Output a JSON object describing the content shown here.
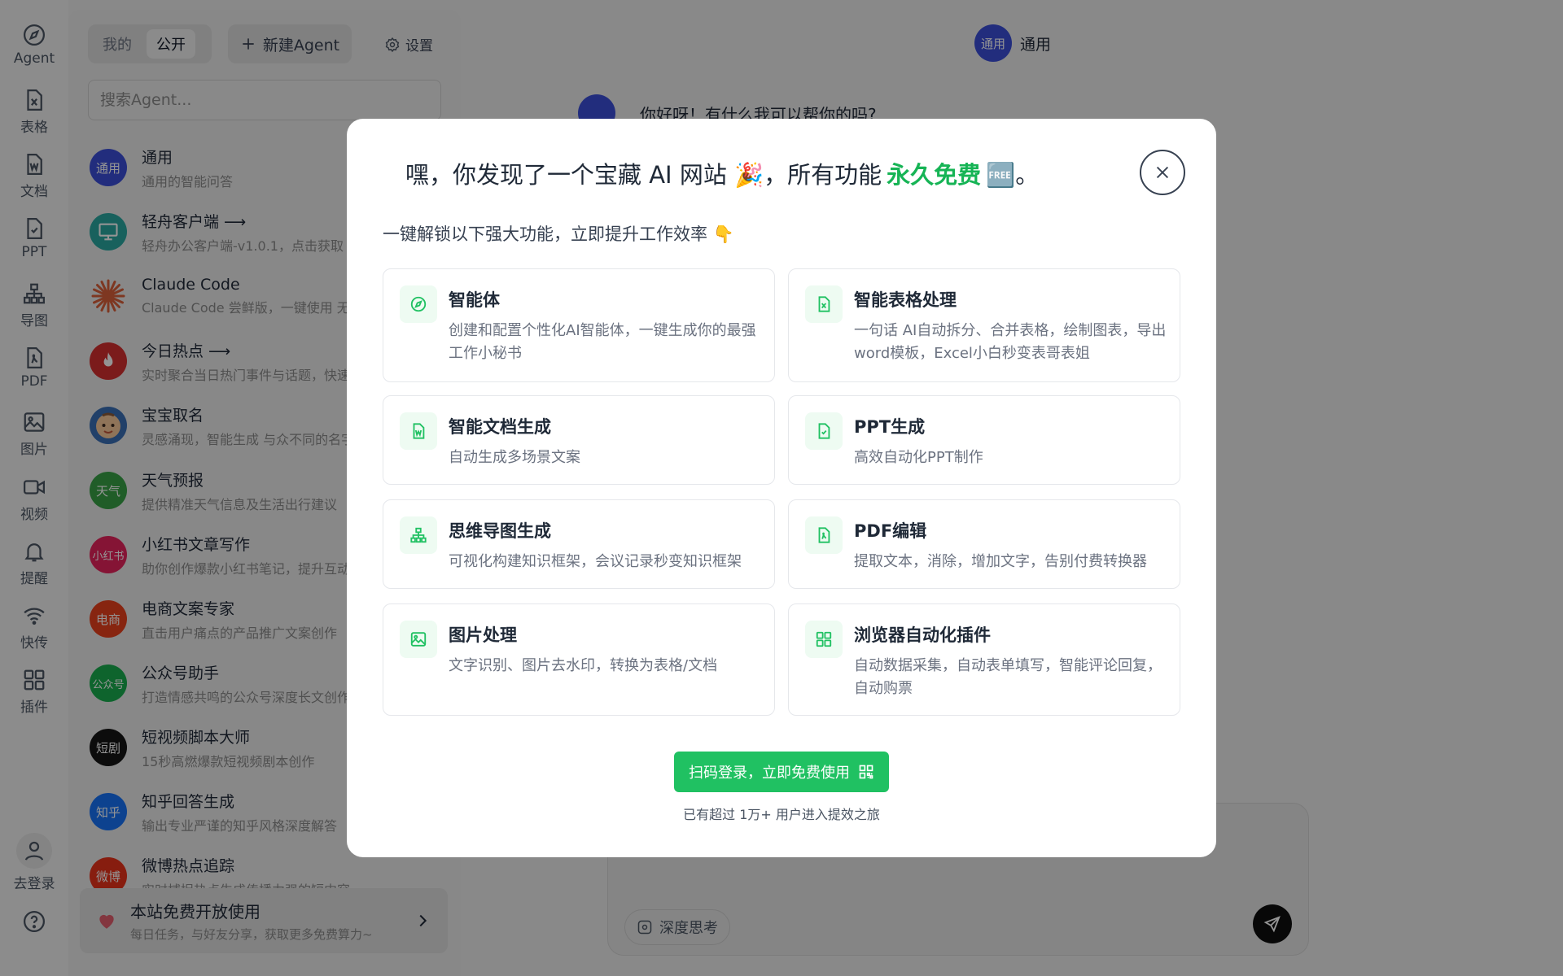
{
  "rail": {
    "items": [
      {
        "label": "Agent",
        "icon": "compass-icon"
      },
      {
        "label": "表格",
        "icon": "excel-file-icon"
      },
      {
        "label": "文档",
        "icon": "word-file-icon"
      },
      {
        "label": "PPT",
        "icon": "ppt-file-icon"
      },
      {
        "label": "导图",
        "icon": "mindmap-icon"
      },
      {
        "label": "PDF",
        "icon": "pdf-file-icon"
      },
      {
        "label": "图片",
        "icon": "image-icon"
      },
      {
        "label": "视频",
        "icon": "video-icon"
      },
      {
        "label": "提醒",
        "icon": "bell-icon"
      },
      {
        "label": "快传",
        "icon": "wifi-icon"
      },
      {
        "label": "插件",
        "icon": "plugin-grid-icon"
      }
    ],
    "login_label": "去登录"
  },
  "panel": {
    "tab_mine": "我的",
    "tab_public": "公开",
    "new_agent": "新建Agent",
    "settings": "设置",
    "search_placeholder": "搜索Agent...",
    "agents": [
      {
        "name": "通用",
        "desc": "通用的智能问答",
        "avatar_text": "通用",
        "color": "#3b4ed8"
      },
      {
        "name": "轻舟客户端 ⟶",
        "desc": "轻舟办公客户端-v1.0.1，点击获取",
        "avatar_text": "",
        "color": "#2aa7a0"
      },
      {
        "name": "Claude Code",
        "desc": "Claude Code 尝鲜版，一键使用 无",
        "avatar_text": "",
        "color": "#d9603a"
      },
      {
        "name": "今日热点 ⟶",
        "desc": "实时聚合当日热门事件与话题，快速",
        "avatar_text": "",
        "color": "#d42f2f"
      },
      {
        "name": "宝宝取名",
        "desc": "灵感涌现，智能生成 与众不同的名字",
        "avatar_text": "",
        "color": "#3a6fb5"
      },
      {
        "name": "天气预报",
        "desc": "提供精准天气信息及生活出行建议",
        "avatar_text": "天气",
        "color": "#37a146"
      },
      {
        "name": "小红书文章写作",
        "desc": "助你创作爆款小红书笔记，提升互动",
        "avatar_text": "小红书",
        "color": "#e6245c"
      },
      {
        "name": "电商文案专家",
        "desc": "直击用户痛点的产品推广文案创作",
        "avatar_text": "电商",
        "color": "#e8401c"
      },
      {
        "name": "公众号助手",
        "desc": "打造情感共鸣的公众号深度长文创作",
        "avatar_text": "公众号",
        "color": "#19ad4f"
      },
      {
        "name": "短视频脚本大师",
        "desc": "15秒高燃爆款短视频剧本创作",
        "avatar_text": "短剧",
        "color": "#151515"
      },
      {
        "name": "知乎回答生成",
        "desc": "输出专业严谨的知乎风格深度解答",
        "avatar_text": "知乎",
        "color": "#1772f6"
      },
      {
        "name": "微博热点追踪",
        "desc": "实时捕捉热点生成传播力强的短内容",
        "avatar_text": "微博",
        "color": "#e8321b"
      }
    ],
    "promo_title": "本站免费开放使用",
    "promo_desc": "每日任务，与好友分享，获取更多免费算力~"
  },
  "chat": {
    "header_avatar": "通用",
    "header_title": "通用",
    "greeting": "你好呀！有什么我可以帮你的吗?",
    "deep_think": "深度思考"
  },
  "modal": {
    "title_pre": "嘿，你发现了一个宝藏 AI 网站 🎉，所有功能",
    "title_highlight": "永久免费",
    "title_post": "🆓。",
    "subtitle": "一键解锁以下强大功能，立即提升工作效率 👇",
    "features": [
      {
        "title": "智能体",
        "desc": "创建和配置个性化AI智能体，一键生成你的最强工作小秘书",
        "icon": "compass-icon"
      },
      {
        "title": "智能表格处理",
        "desc": "一句话 AI自动拆分、合并表格，绘制图表，导出word模板，Excel小白秒变表哥表姐",
        "icon": "excel-file-icon"
      },
      {
        "title": "智能文档生成",
        "desc": "自动生成多场景文案",
        "icon": "word-file-icon"
      },
      {
        "title": "PPT生成",
        "desc": "高效自动化PPT制作",
        "icon": "ppt-file-icon"
      },
      {
        "title": "思维导图生成",
        "desc": "可视化构建知识框架，会议记录秒变知识框架",
        "icon": "mindmap-icon"
      },
      {
        "title": "PDF编辑",
        "desc": "提取文本，消除，增加文字，告别付费转换器",
        "icon": "pdf-file-icon"
      },
      {
        "title": "图片处理",
        "desc": "文字识别、图片去水印，转换为表格/文档",
        "icon": "image-icon"
      },
      {
        "title": "浏览器自动化插件",
        "desc": "自动数据采集，自动表单填写，智能评论回复，自动购票",
        "icon": "plugin-grid-icon"
      }
    ],
    "cta": "扫码登录，立即免费使用",
    "note": "已有超过 1万+ 用户进入提效之旅"
  },
  "colors": {
    "accent": "#20c162",
    "highlight": "#16b455",
    "brand_blue": "#3b4ed8"
  }
}
